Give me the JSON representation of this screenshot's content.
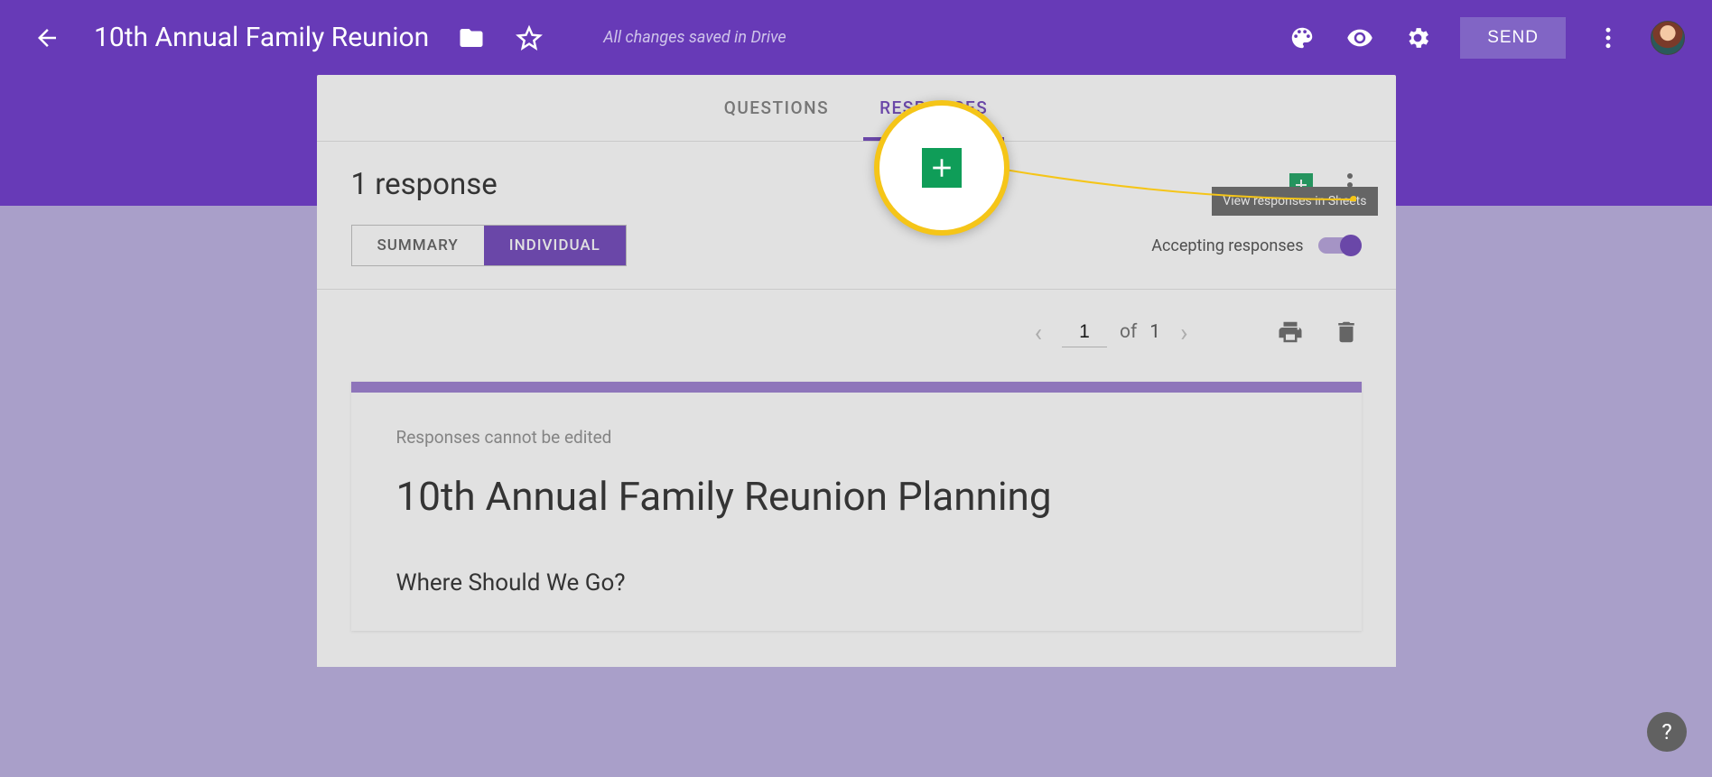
{
  "header": {
    "title": "10th Annual Family Reunion",
    "status": "All changes saved in Drive",
    "send_label": "SEND"
  },
  "tabs": {
    "questions": "QUESTIONS",
    "responses": "RESPONSES"
  },
  "responses": {
    "count_label": "1 response",
    "tooltip": "View responses in Sheets",
    "summary": "SUMMARY",
    "individual": "INDIVIDUAL",
    "accepting_label": "Accepting responses",
    "pager": {
      "current": "1",
      "of": "of",
      "total": "1"
    },
    "noedit": "Responses cannot be edited",
    "form_title": "10th Annual Family Reunion Planning",
    "question1": "Where Should We Go?"
  },
  "help": "?"
}
